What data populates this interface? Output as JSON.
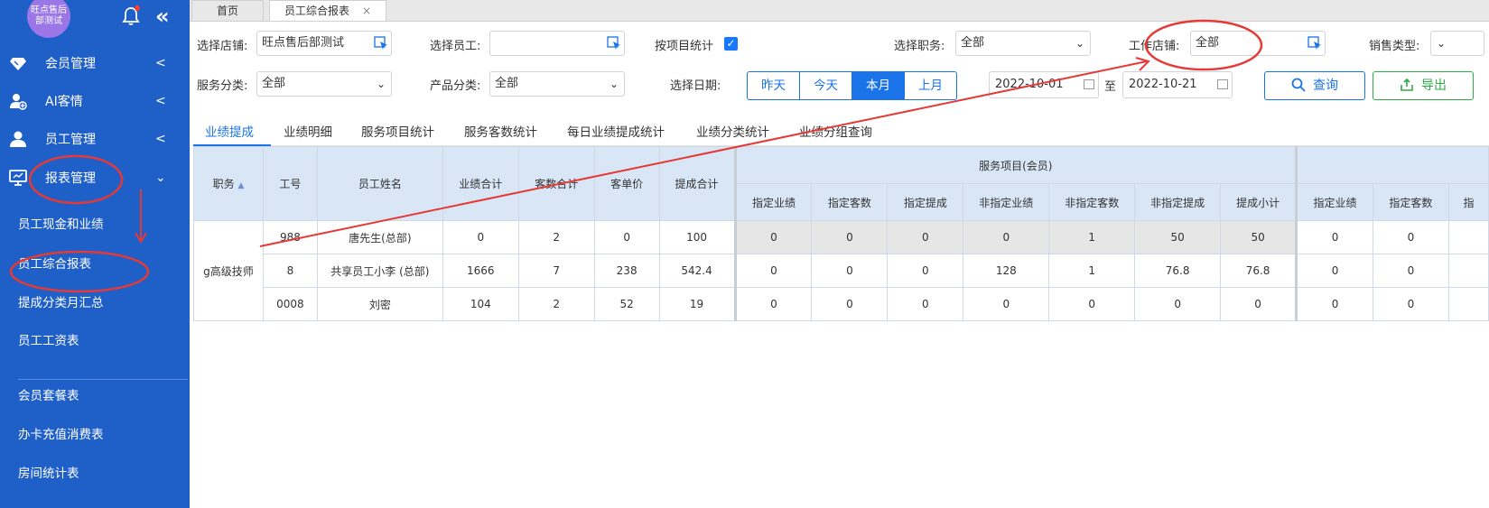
{
  "sidebar": {
    "avatar_text": "旺点售后部测试",
    "menu": [
      {
        "label": "会员管理",
        "icon": "diamond-icon"
      },
      {
        "label": "AI客情",
        "icon": "user-plus-icon"
      },
      {
        "label": "员工管理",
        "icon": "user-icon"
      },
      {
        "label": "报表管理",
        "icon": "monitor-icon"
      }
    ],
    "submenu": [
      "员工现金和业绩",
      "员工综合报表",
      "提成分类月汇总",
      "员工工资表"
    ],
    "submenu2": [
      "会员套餐表",
      "办卡充值消费表",
      "房间统计表"
    ]
  },
  "page_tabs": {
    "home": "首页",
    "active": "员工综合报表",
    "close": "×"
  },
  "filters": {
    "store_label": "选择店铺:",
    "store_value": "旺点售后部测试",
    "employee_label": "选择员工:",
    "employee_value": "",
    "by_item_label": "按项目统计",
    "position_label": "选择职务:",
    "position_value": "全部",
    "work_store_label": "工作店铺:",
    "work_store_value": "全部",
    "sales_type_label": "销售类型:",
    "service_cat_label": "服务分类:",
    "service_cat_value": "全部",
    "product_cat_label": "产品分类:",
    "product_cat_value": "全部",
    "date_label": "选择日期:",
    "date_options": [
      "昨天",
      "今天",
      "本月",
      "上月"
    ],
    "date_selected": "本月",
    "date_from": "2022-10-01",
    "date_to_sep": "至",
    "date_to": "2022-10-21",
    "query_btn": "查询",
    "export_btn": "导出"
  },
  "report_tabs": [
    "业绩提成",
    "业绩明细",
    "服务项目统计",
    "服务客数统计",
    "每日业绩提成统计",
    "业绩分类统计",
    "业绩分组查询"
  ],
  "table": {
    "fixed_headers": [
      "职务",
      "工号",
      "员工姓名",
      "业绩合计",
      "客数合计",
      "客单价",
      "提成合计"
    ],
    "sort_icon": "▲",
    "group1_title": "服务项目(会员)",
    "group1_cols": [
      "指定业绩",
      "指定客数",
      "指定提成",
      "非指定业绩",
      "非指定客数",
      "非指定提成",
      "提成小计"
    ],
    "group2_cols": [
      "指定业绩",
      "指定客数",
      "指"
    ],
    "role": "g高级技师",
    "rows": [
      {
        "id": "988",
        "name": "唐先生(总部)",
        "total": "0",
        "clients": "2",
        "avg": "0",
        "commission": "100",
        "g1": [
          "0",
          "0",
          "0",
          "0",
          "1",
          "50",
          "50"
        ],
        "g2": [
          "0",
          "0"
        ]
      },
      {
        "id": "8",
        "name": "共享员工小李 (总部)",
        "total": "1666",
        "clients": "7",
        "avg": "238",
        "commission": "542.4",
        "g1": [
          "0",
          "0",
          "0",
          "128",
          "1",
          "76.8",
          "76.8"
        ],
        "g2": [
          "0",
          "0"
        ]
      },
      {
        "id": "0008",
        "name": "刘密",
        "total": "104",
        "clients": "2",
        "avg": "52",
        "commission": "19",
        "g1": [
          "0",
          "0",
          "0",
          "0",
          "0",
          "0",
          "0"
        ],
        "g2": [
          "0",
          "0"
        ]
      }
    ]
  },
  "colors": {
    "sidebar": "#1f5fc8",
    "accent": "#1a73e8",
    "export": "#2eaa47",
    "annotation": "#e53935"
  }
}
